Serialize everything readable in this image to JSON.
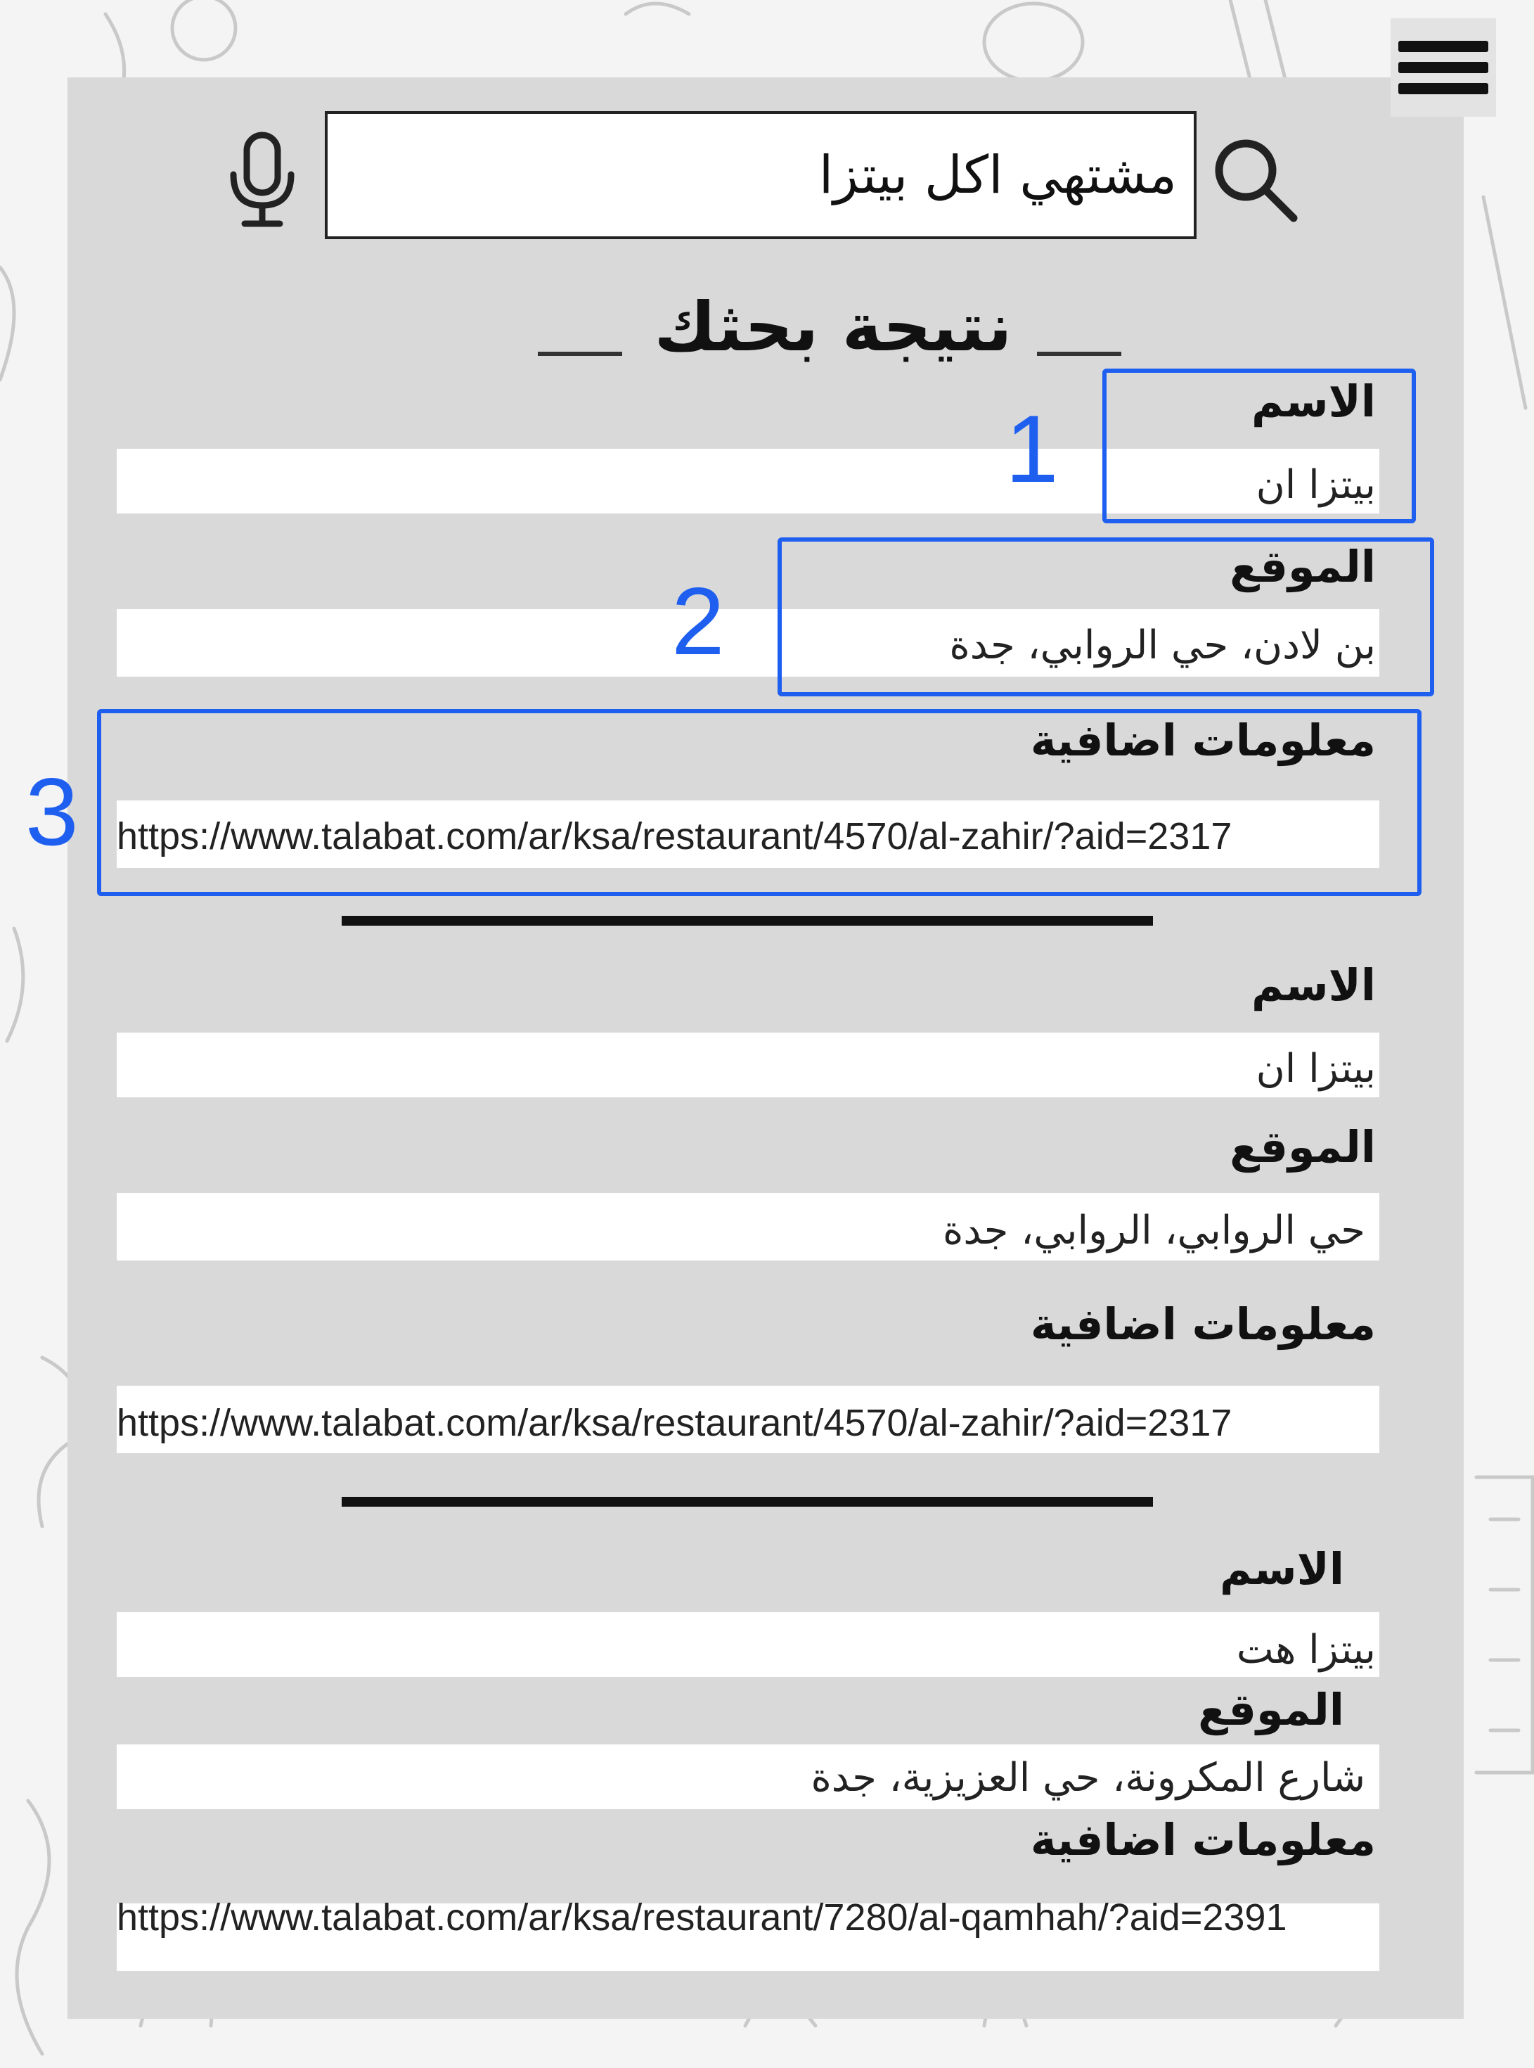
{
  "search": {
    "value": "مشتهي اكل بيتزا"
  },
  "results_title": "نتيجة بحثك",
  "results": [
    {
      "name_label": "الاسم",
      "name": "بيتزا ان",
      "location_label": "الموقع",
      "location": "بن لادن، حي الروابي، جدة",
      "info_label": "معلومات اضافية",
      "info": "https://www.talabat.com/ar/ksa/restaurant/4570/al-zahir/?aid=2317"
    },
    {
      "name_label": "الاسم",
      "name": "بيتزا ان",
      "location_label": "الموقع",
      "location": "حي الروابي، الروابي، جدة",
      "info_label": "معلومات اضافية",
      "info": "https://www.talabat.com/ar/ksa/restaurant/4570/al-zahir/?aid=2317"
    },
    {
      "name_label": "الاسم",
      "name": "بيتزا هت",
      "location_label": "الموقع",
      "location": "شارع المكرونة، حي العزيزية، جدة",
      "info_label": "معلومات اضافية",
      "info": "https://www.talabat.com/ar/ksa/restaurant/7280/al-qamhah/?aid=2391"
    }
  ],
  "annotations": [
    "1",
    "2",
    "3"
  ],
  "colors": {
    "annotation": "#1f5ff0",
    "panel": "#d9d9d9",
    "field": "#ffffff"
  },
  "icons": {
    "menu": "hamburger-menu-icon",
    "search": "search-icon",
    "mic": "microphone-icon"
  }
}
